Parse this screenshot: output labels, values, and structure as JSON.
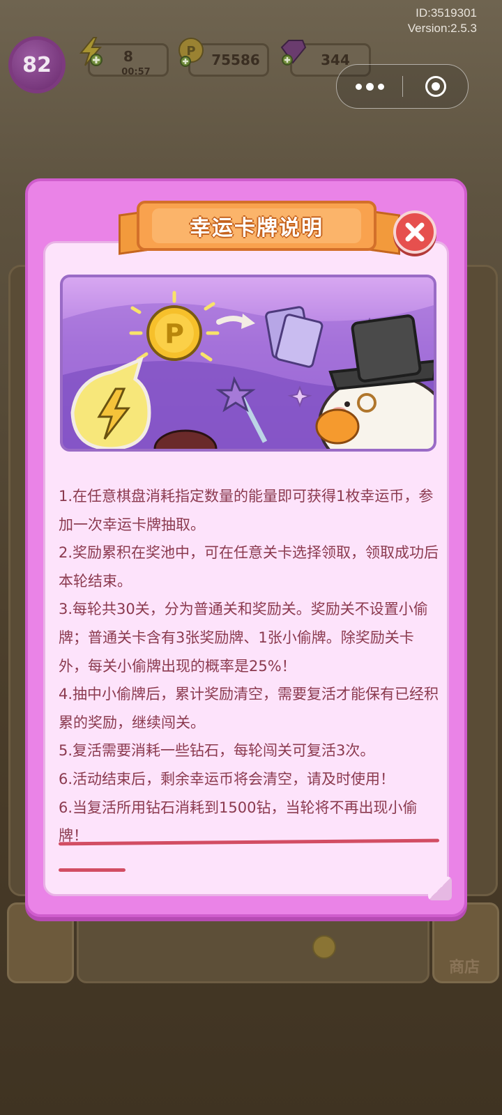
{
  "hud": {
    "id_text": "ID:3519301",
    "version_text": "Version:2.5.3",
    "level": "82",
    "energy": "8",
    "energy_timer": "00:57",
    "coins": "75586",
    "gems": "344"
  },
  "background": {
    "shop_label": "商店"
  },
  "modal": {
    "title": "幸运卡牌说明",
    "rules": [
      "1.在任意棋盘消耗指定数量的能量即可获得1枚幸运币，参加一次幸运卡牌抽取。",
      "2.奖励累积在奖池中，可在任意关卡选择领取，领取成功后本轮结束。",
      "3.每轮共30关，分为普通关和奖励关。奖励关不设置小偷牌；普通关卡含有3张奖励牌、1张小偷牌。除奖励关卡外，每关小偷牌出现的概率是25%！",
      "4.抽中小偷牌后，累计奖励清空，需要复活才能保有已经积累的奖励，继续闯关。",
      "5.复活需要消耗一些钻石，每轮闯关可复活3次。",
      "6.活动结束后，剩余幸运币将会清空，请及时使用！",
      "6.当复活所用钻石消耗到1500钻，当轮将不再出现小偷牌！"
    ]
  },
  "colors": {
    "modal_bg": "#ea83e7",
    "panel_bg": "#fde3fb",
    "title_orange": "#f9a24e",
    "close_red": "#e6504e",
    "text": "#8b3a4f",
    "underline": "#d24d63"
  },
  "icons": [
    "energy-bolt-icon",
    "coin-icon",
    "gem-icon",
    "more-dots-icon",
    "target-icon",
    "close-icon",
    "p-coin-icon",
    "card-icon",
    "magic-wand-icon"
  ]
}
